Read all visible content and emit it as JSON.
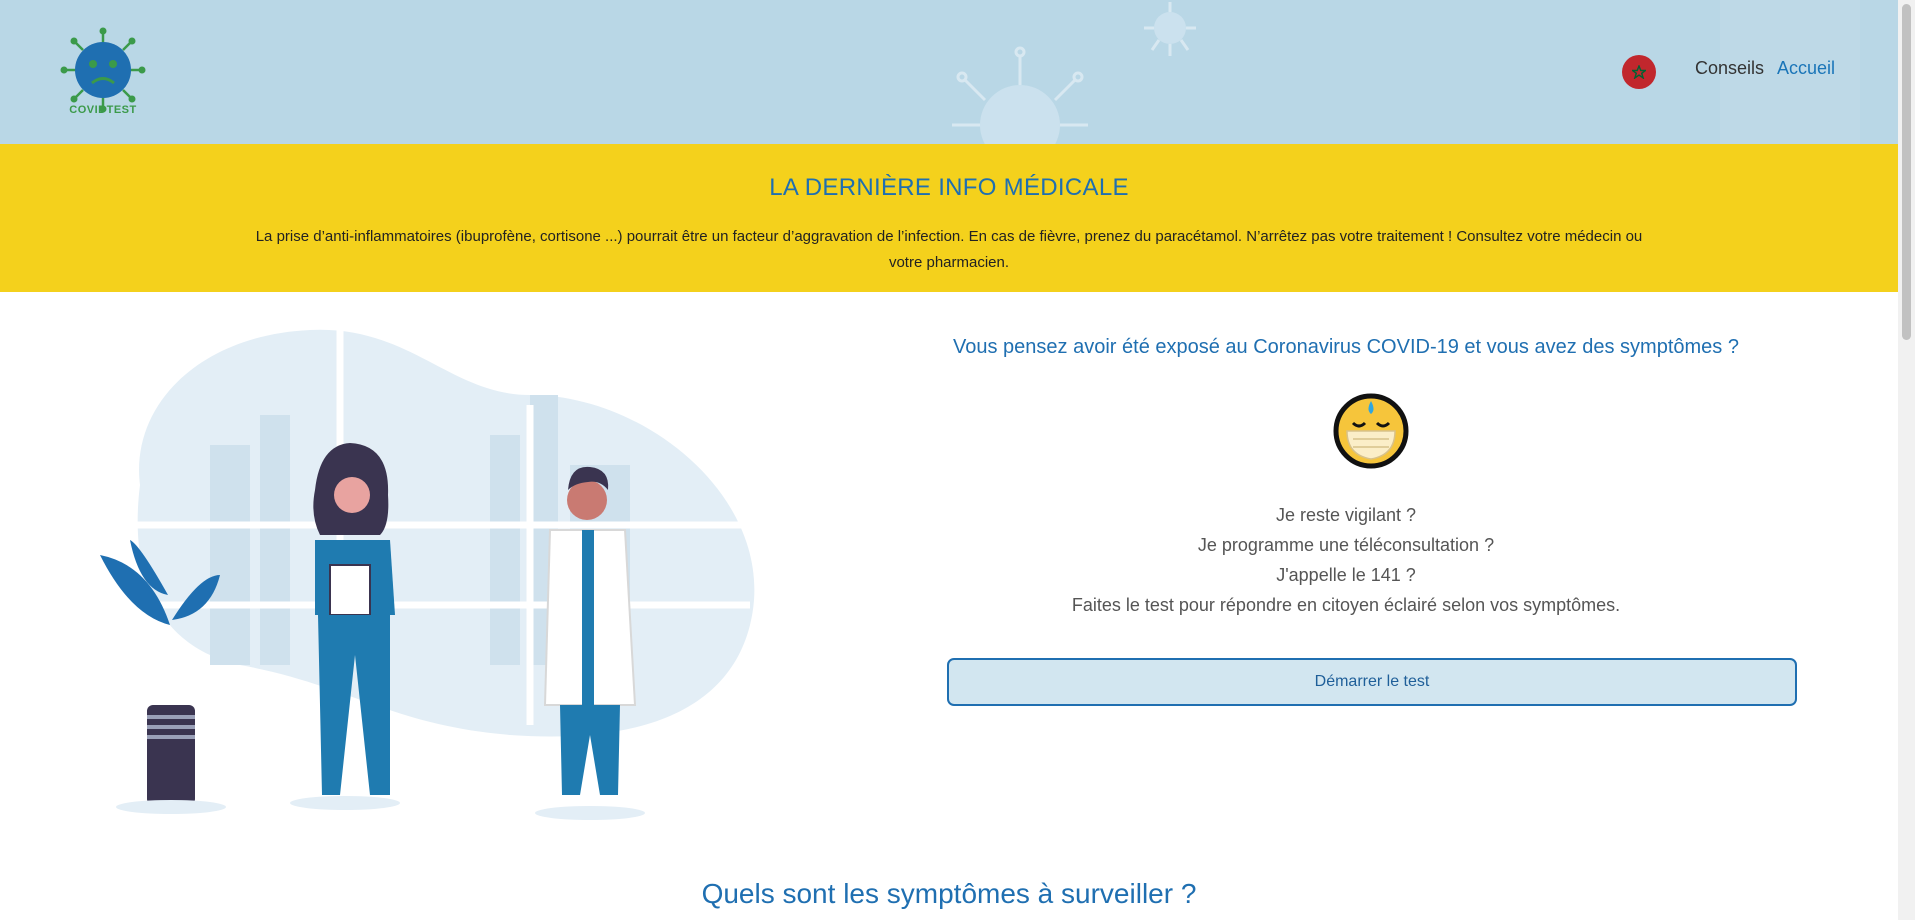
{
  "header": {
    "logo_text": "COVIDTEST",
    "nav": {
      "conseils": "Conseils",
      "accueil": "Accueil"
    }
  },
  "banner": {
    "title": "LA DERNIÈRE INFO MÉDICALE",
    "text": "La prise d’anti-inflammatoires (ibuprofène, cortisone ...) pourrait être un facteur d’aggravation de l’infection. En cas de fièvre, prenez du paracétamol. N’arrêtez pas votre traitement ! Consultez votre médecin ou votre pharmacien."
  },
  "main": {
    "question": "Vous pensez avoir été exposé au Coronavirus COVID-19 et vous avez des symptômes ?",
    "lines": [
      "Je reste vigilant ?",
      "Je programme une téléconsultation ?",
      "J'appelle le 141 ?",
      "Faites le test pour répondre en citoyen éclairé selon vos symptômes."
    ],
    "start_button": "Démarrer le test"
  },
  "section": {
    "title": "Quels sont les symptômes à surveiller ?"
  },
  "colors": {
    "header_bg": "#b9d7e6",
    "banner_bg": "#f4d11c",
    "accent": "#1f6fb1",
    "flag_red": "#c1272d"
  }
}
